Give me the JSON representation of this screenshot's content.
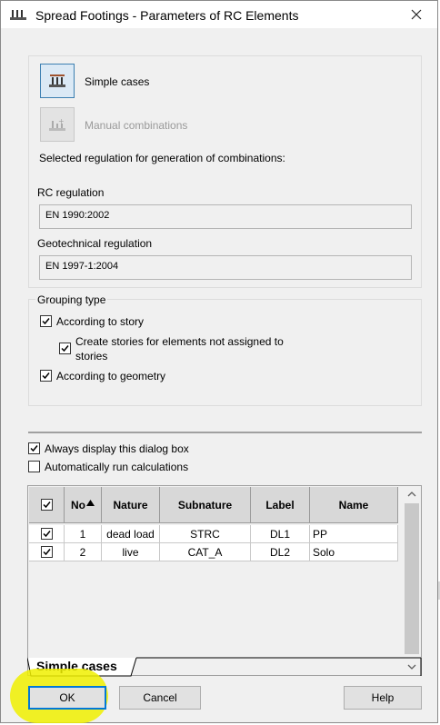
{
  "window": {
    "title": "Spread Footings - Parameters of RC Elements",
    "title_icon": "footing-icon",
    "close_icon": "close-icon"
  },
  "modes": {
    "simple_label": "Simple cases",
    "manual_label": "Manual combinations",
    "heading": "Selected regulation for generation of combinations:"
  },
  "regulations": {
    "rc_label": "RC regulation",
    "rc_value": "EN 1990:2002",
    "geo_label": "Geotechnical regulation",
    "geo_value": "EN 1997-1:2004"
  },
  "grouping": {
    "title": "Grouping type",
    "by_story": {
      "label": "According to story",
      "checked": true
    },
    "create_stories": {
      "label_line1": "Create stories for elements not assigned to",
      "label_line2": "stories",
      "checked": true
    },
    "by_geometry": {
      "label": "According to geometry",
      "checked": true
    }
  },
  "options": {
    "always_display": {
      "label": "Always display this dialog box",
      "checked": true
    },
    "auto_run": {
      "label": "Automatically run calculations",
      "checked": false
    }
  },
  "table": {
    "columns": [
      "No",
      "Nature",
      "Subnature",
      "Label",
      "Name"
    ],
    "sort_column": "No",
    "rows": [
      {
        "checked": true,
        "no": "1",
        "nature": "dead load",
        "subnature": "STRC",
        "label": "DL1",
        "name": "PP"
      },
      {
        "checked": true,
        "no": "2",
        "nature": "live",
        "subnature": "CAT_A",
        "label": "DL2",
        "name": "Solo"
      }
    ]
  },
  "tab": {
    "label": "Simple cases"
  },
  "buttons": {
    "ok": "OK",
    "cancel": "Cancel",
    "help": "Help"
  },
  "colors": {
    "accent": "#0078d7",
    "highlight": "#f0f000"
  }
}
